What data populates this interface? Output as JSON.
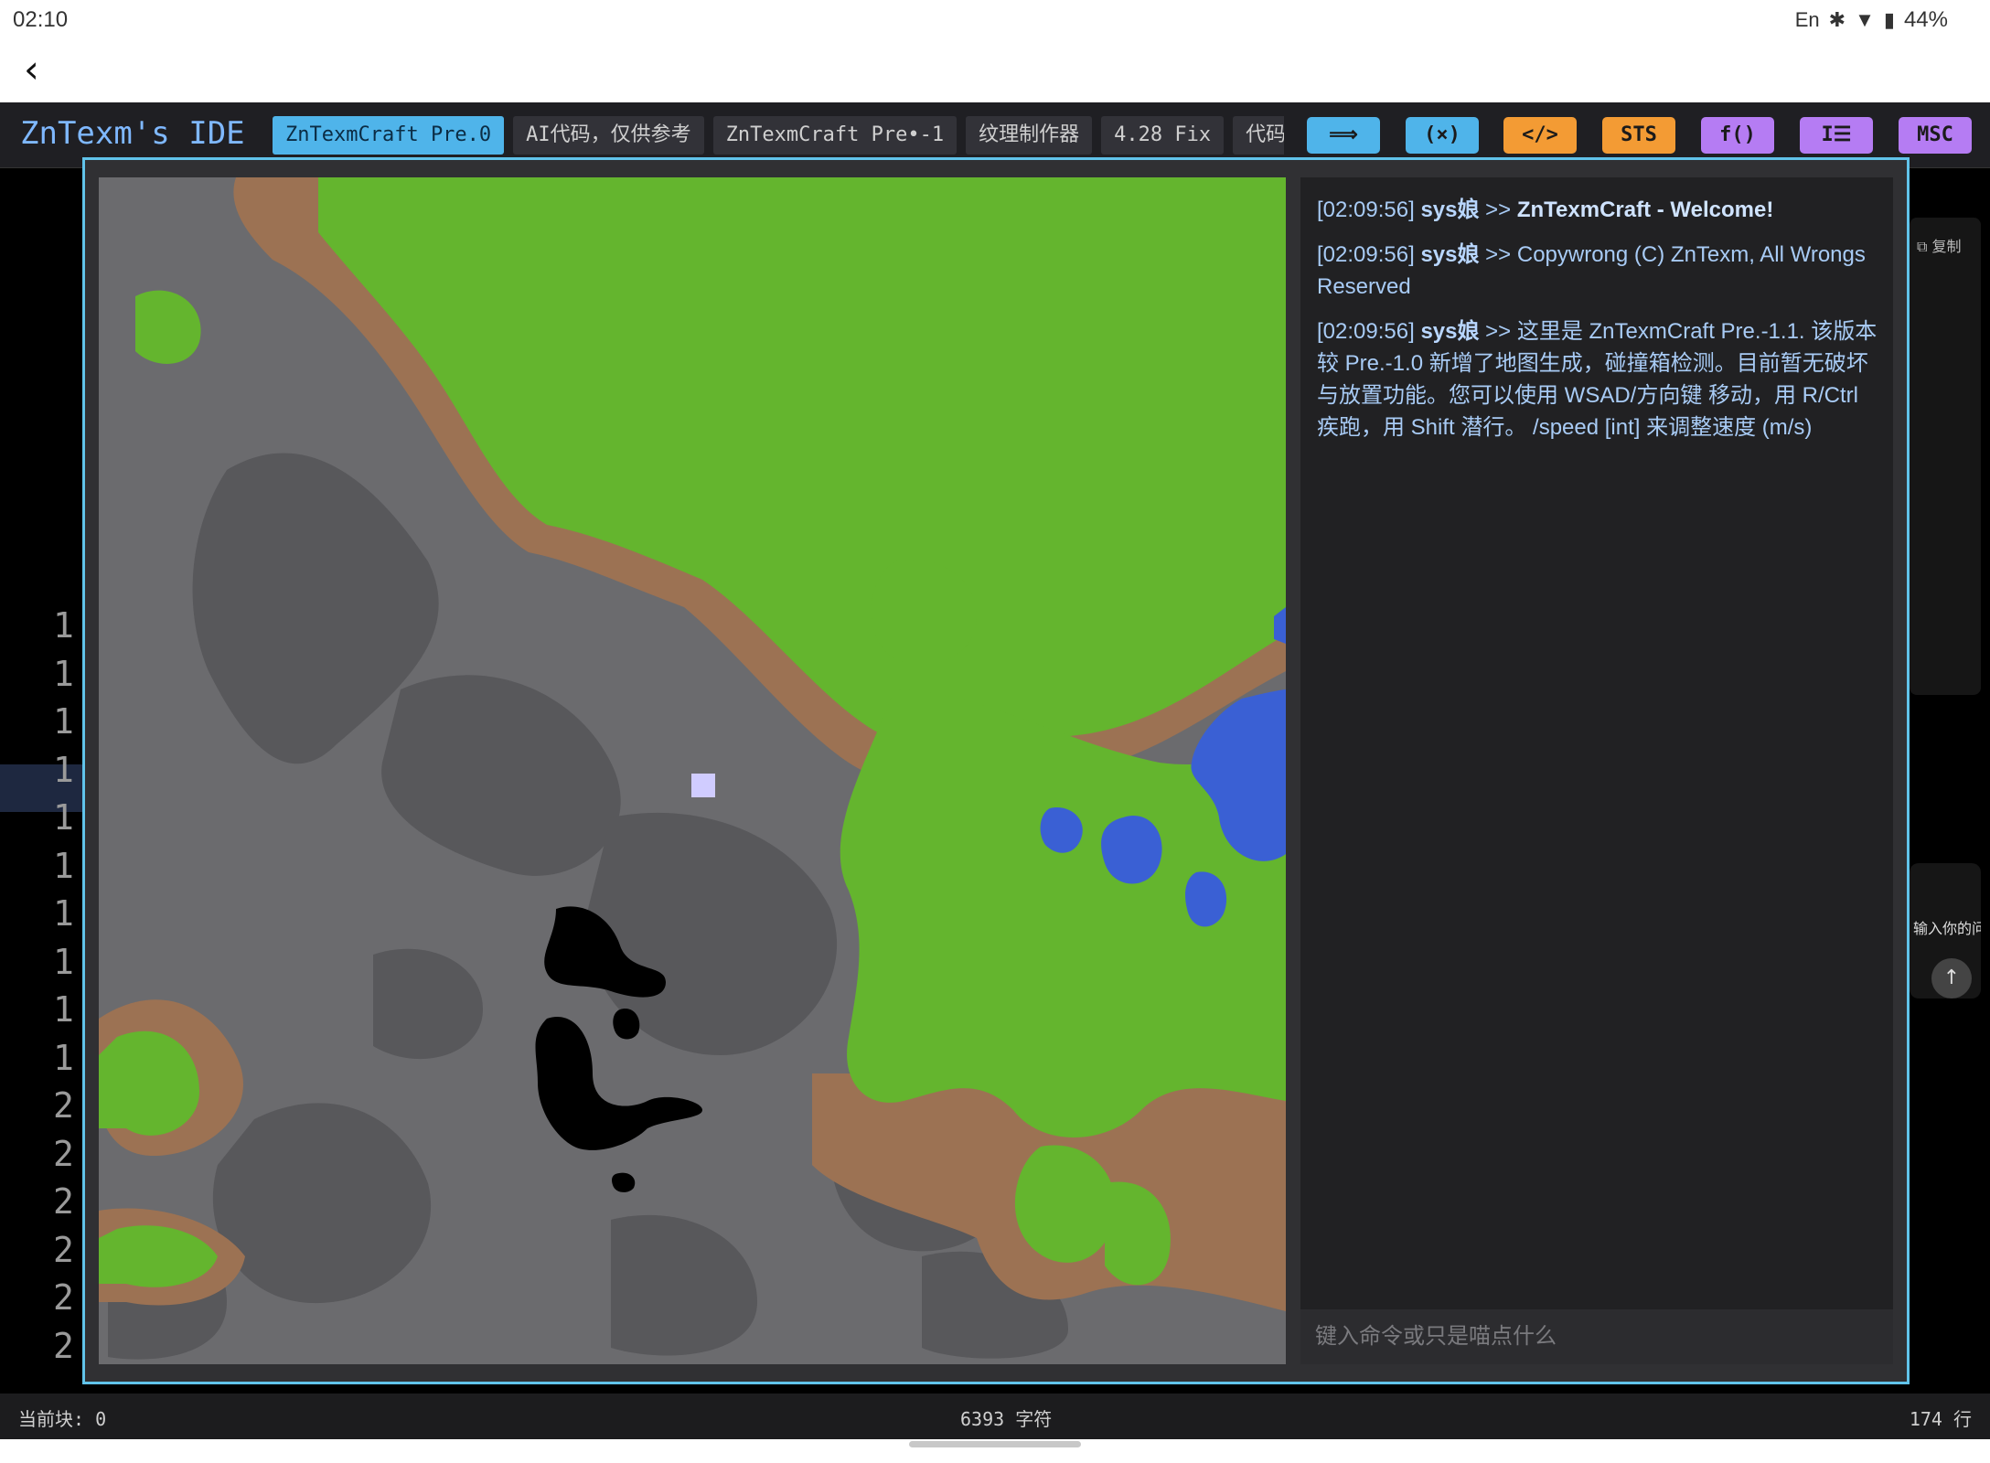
{
  "status_bar": {
    "time": "02:10",
    "lang": "En",
    "battery": "44%"
  },
  "ide": {
    "title": "ZnTexm's IDE",
    "tabs": [
      {
        "label": "ZnTexmCraft Pre.0",
        "active": true
      },
      {
        "label": "AI代码，仅供参考",
        "active": false
      },
      {
        "label": "ZnTexmCraft Pre•-1",
        "active": false
      },
      {
        "label": "纹理制作器",
        "active": false
      },
      {
        "label": "4.28 Fix",
        "active": false
      },
      {
        "label": "代码补全",
        "active": false
      }
    ],
    "tools": [
      {
        "label": "⟹",
        "color": "#4fb4ea"
      },
      {
        "label": "(×)",
        "color": "#4fb4ea"
      },
      {
        "label": "</>",
        "color": "#f39b34"
      },
      {
        "label": "STS",
        "color": "#f39b34"
      },
      {
        "label": "f()",
        "color": "#b57cf3"
      },
      {
        "label": "I☰",
        "color": "#b57cf3"
      },
      {
        "label": "MSC",
        "color": "#b57cf3"
      }
    ],
    "line_numbers": [
      "1",
      "1",
      "1",
      "1",
      "1",
      "1",
      "1",
      "1",
      "1",
      "1",
      "2",
      "2",
      "2",
      "2",
      "2",
      "2"
    ],
    "right_panel": {
      "copy_label": "复制",
      "input_hint": "输入你的问"
    },
    "footer": {
      "current_block": "当前块: 0",
      "chars": "6393 字符",
      "lines": "174 行"
    }
  },
  "game": {
    "chat": [
      {
        "time": "[02:09:56]",
        "who": "sys娘",
        "arrow": ">>",
        "text": "ZnTexmCraft - Welcome!",
        "bold": true
      },
      {
        "time": "[02:09:56]",
        "who": "sys娘",
        "arrow": ">>",
        "text": "Copywrong (C) ZnTexm, All Wrongs Reserved",
        "bold": false
      },
      {
        "time": "[02:09:56]",
        "who": "sys娘",
        "arrow": ">>",
        "text": "这里是 ZnTexmCraft Pre.-1.1. 该版本较 Pre.-1.0 新增了地图生成，碰撞箱检测。目前暂无破坏与放置功能。您可以使用 WSAD/方向键 移动，用 R/Ctrl 疾跑，用 Shift 潜行。 /speed [int] 来调整速度 (m/s)",
        "bold": false
      }
    ],
    "input_placeholder": "键入命令或只是喵点什么",
    "terrain_colors": {
      "stone": "#6b6b6e",
      "dark_stone": "#58585b",
      "dirt": "#9c7253",
      "grass": "#64b52e",
      "water": "#3a60d4",
      "void": "#000000",
      "player": "#d0ccff"
    }
  }
}
